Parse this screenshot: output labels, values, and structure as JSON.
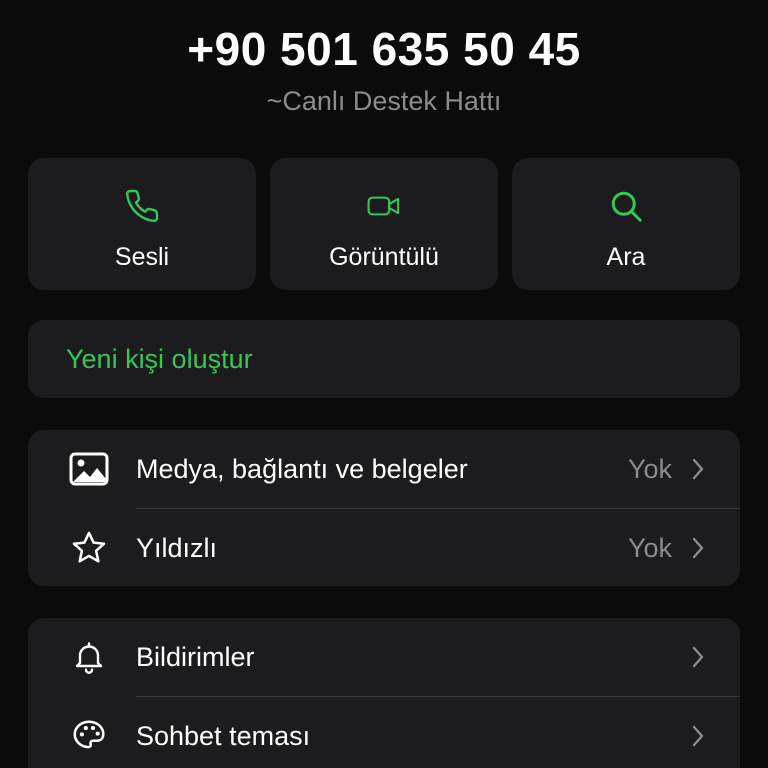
{
  "contact": {
    "phone": "+90 501 635 50 45",
    "name": "~Canlı Destek Hattı"
  },
  "actions": [
    {
      "label": "Sesli",
      "icon": "phone-icon"
    },
    {
      "label": "Görüntülü",
      "icon": "video-camera-icon"
    },
    {
      "label": "Ara",
      "icon": "search-icon"
    }
  ],
  "new_contact": {
    "label": "Yeni kişi oluştur"
  },
  "section1": {
    "rows": [
      {
        "label": "Medya, bağlantı ve belgeler",
        "value": "Yok",
        "icon": "photo-icon"
      },
      {
        "label": "Yıldızlı",
        "value": "Yok",
        "icon": "star-icon"
      }
    ]
  },
  "section2": {
    "rows": [
      {
        "label": "Bildirimler",
        "value": "",
        "icon": "bell-icon"
      },
      {
        "label": "Sohbet teması",
        "value": "",
        "icon": "palette-icon"
      }
    ]
  },
  "colors": {
    "background": "#0b0b0b",
    "card": "#1c1c1e",
    "accent_green": "#34c759",
    "secondary_text": "#8c8c8f",
    "divider": "#38383a"
  }
}
